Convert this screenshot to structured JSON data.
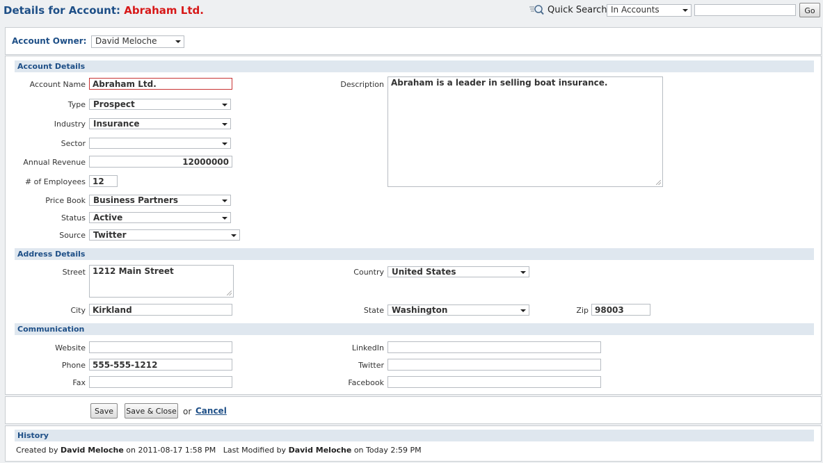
{
  "header": {
    "title_prefix": "Details for Account:",
    "account_name": "Abraham Ltd.",
    "accent_color": "#d71818",
    "title_color": "#1e4f87"
  },
  "quick_search": {
    "icon": "search-magnifier-icon",
    "label": "Quick Search",
    "scope": "In Accounts",
    "query": "",
    "go_label": "Go"
  },
  "owner": {
    "label": "Account Owner:",
    "value": "David Meloche"
  },
  "account_details": {
    "heading": "Account Details",
    "account_name": {
      "label": "Account Name",
      "value": "Abraham Ltd."
    },
    "type": {
      "label": "Type",
      "value": "Prospect"
    },
    "industry": {
      "label": "Industry",
      "value": "Insurance"
    },
    "sector": {
      "label": "Sector",
      "value": ""
    },
    "annual_revenue": {
      "label": "Annual Revenue",
      "value": "12000000"
    },
    "employees": {
      "label": "# of Employees",
      "value": "12"
    },
    "price_book": {
      "label": "Price Book",
      "value": "Business Partners"
    },
    "status": {
      "label": "Status",
      "value": "Active"
    },
    "source": {
      "label": "Source",
      "value": "Twitter"
    },
    "description": {
      "label": "Description",
      "value": "Abraham is a leader in selling boat insurance."
    }
  },
  "address_details": {
    "heading": "Address Details",
    "street": {
      "label": "Street",
      "value": "1212 Main Street"
    },
    "city": {
      "label": "City",
      "value": "Kirkland"
    },
    "country": {
      "label": "Country",
      "value": "United States"
    },
    "state": {
      "label": "State",
      "value": "Washington"
    },
    "zip": {
      "label": "Zip",
      "value": "98003"
    }
  },
  "communication": {
    "heading": "Communication",
    "website": {
      "label": "Website",
      "value": ""
    },
    "phone": {
      "label": "Phone",
      "value": "555-555-1212"
    },
    "fax": {
      "label": "Fax",
      "value": ""
    },
    "linkedin": {
      "label": "LinkedIn",
      "value": ""
    },
    "twitter": {
      "label": "Twitter",
      "value": ""
    },
    "facebook": {
      "label": "Facebook",
      "value": ""
    }
  },
  "actions": {
    "save_label": "Save",
    "save_close_label": "Save & Close",
    "or_text": "or",
    "cancel_label": "Cancel"
  },
  "history": {
    "heading": "History",
    "created_prefix": "Created by",
    "created_by": "David Meloche",
    "created_on_prefix": "on",
    "created_on": "2011-08-17 1:58 PM",
    "modified_prefix": "Last Modified by",
    "modified_by": "David Meloche",
    "modified_on_prefix": "on",
    "modified_on": "Today 2:59 PM"
  }
}
